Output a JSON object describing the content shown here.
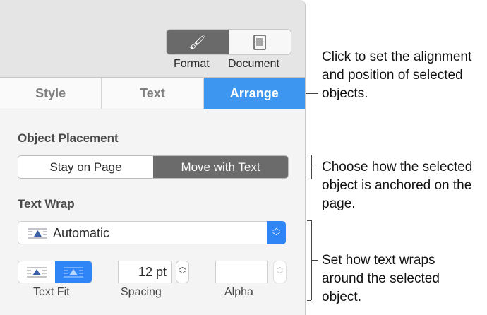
{
  "toolbar": {
    "format_label": "Format",
    "document_label": "Document"
  },
  "tabs": [
    {
      "label": "Style"
    },
    {
      "label": "Text"
    },
    {
      "label": "Arrange",
      "active": true
    }
  ],
  "object_placement": {
    "heading": "Object Placement",
    "options": [
      "Stay on Page",
      "Move with Text"
    ],
    "selected": "Move with Text"
  },
  "text_wrap": {
    "heading": "Text Wrap",
    "value": "Automatic",
    "text_fit_label": "Text Fit",
    "spacing_value": "12 pt",
    "spacing_label": "Spacing",
    "alpha_value": "",
    "alpha_label": "Alpha"
  },
  "callouts": [
    "Click to set the alignment and position of selected objects.",
    "Choose how the selected object is anchored on the page.",
    "Set how text wraps around the selected object."
  ],
  "colors": {
    "accent": "#3d96f0"
  }
}
